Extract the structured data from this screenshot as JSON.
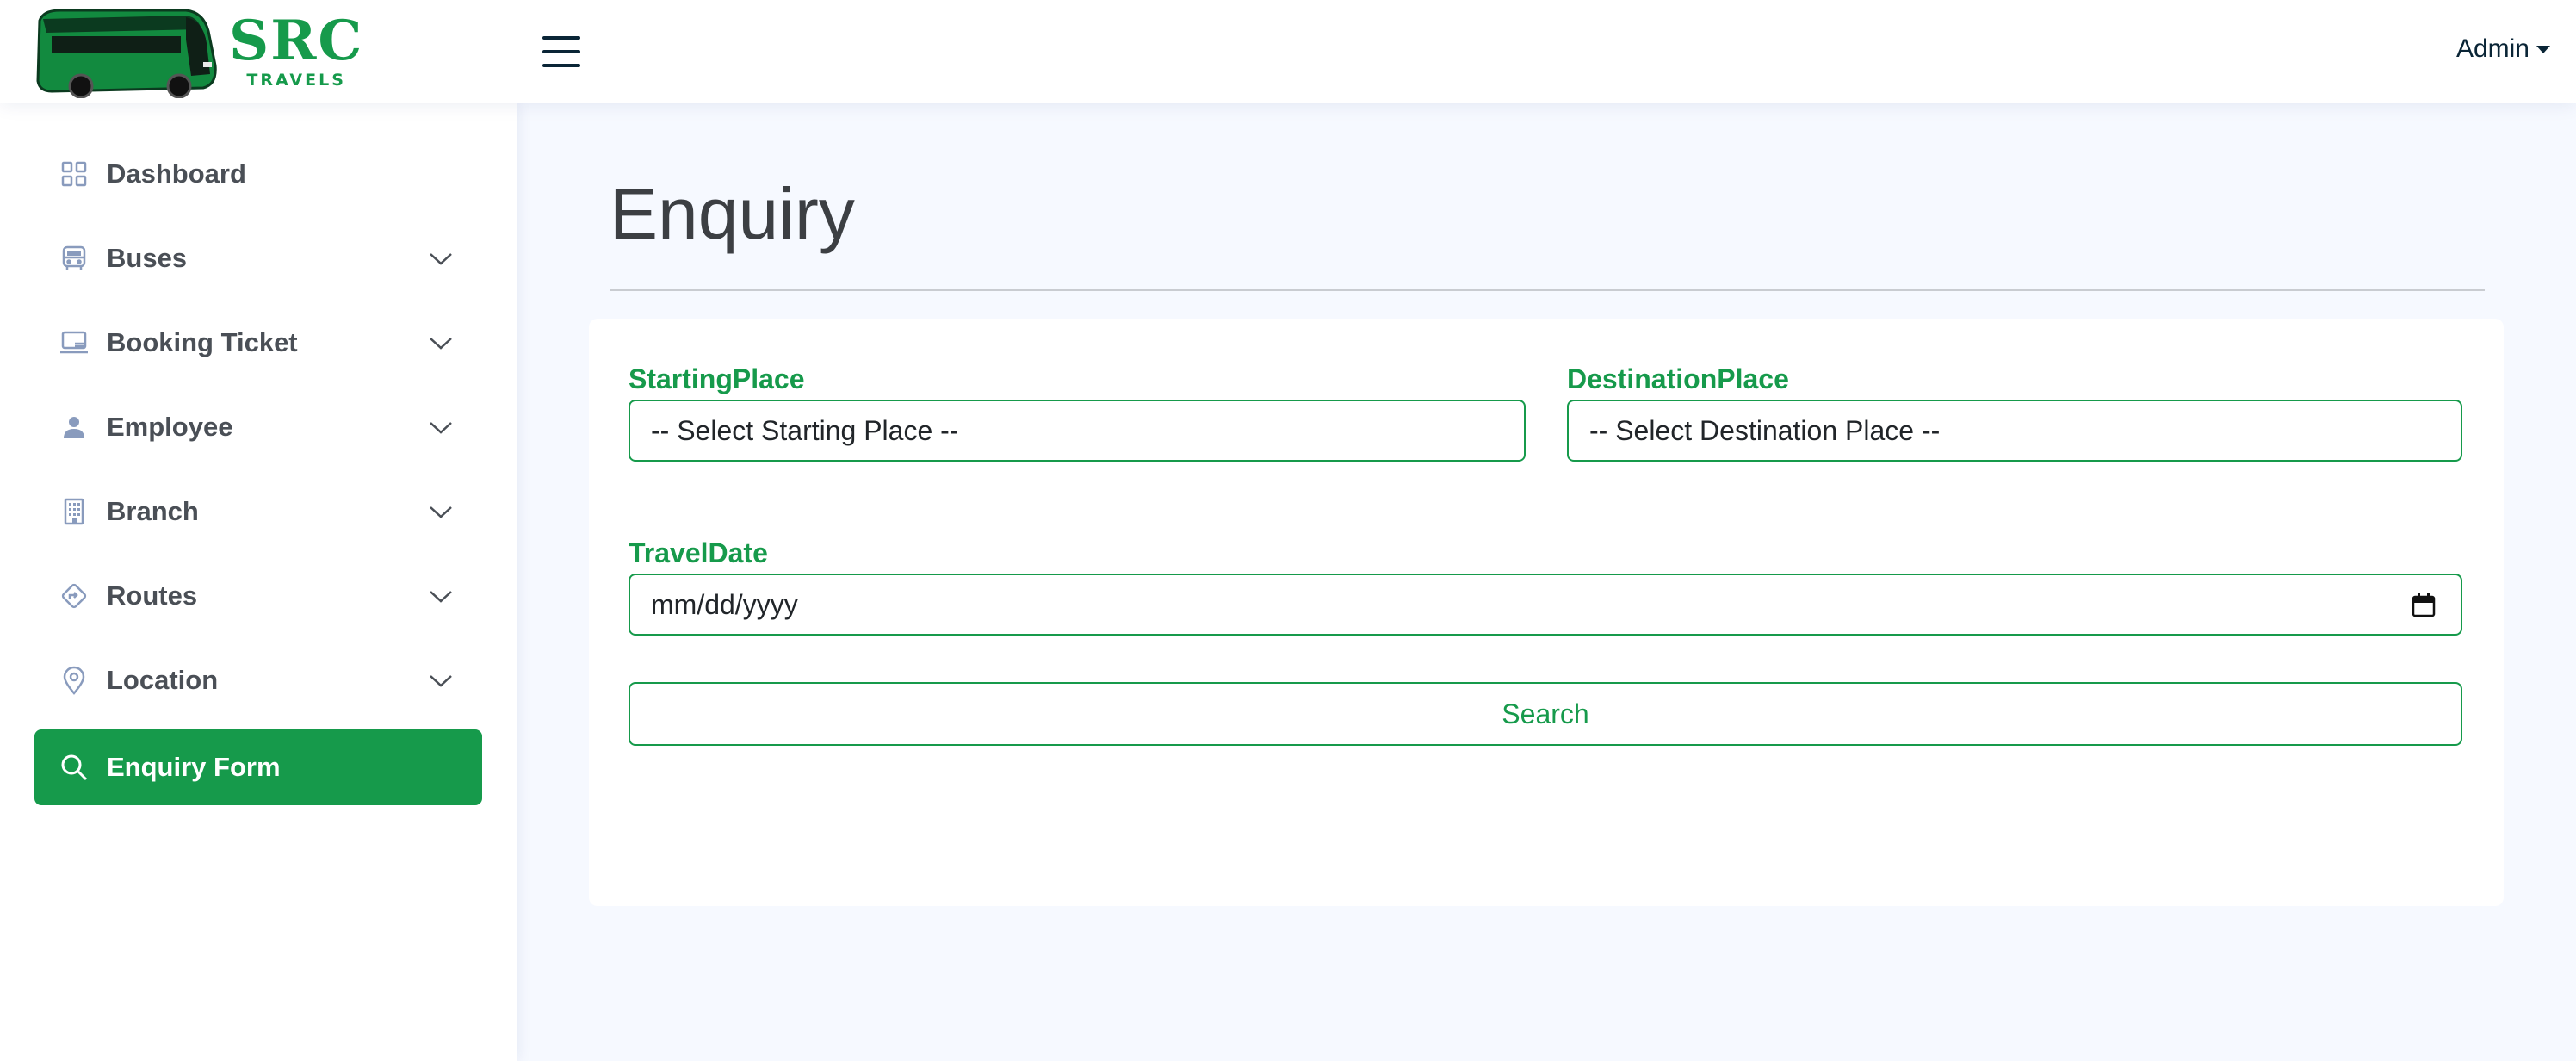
{
  "brand": {
    "name": "SRC",
    "tagline": "TRAVELS",
    "color": "#169a4b"
  },
  "header": {
    "menu_icon": "hamburger-icon",
    "user_label": "Admin"
  },
  "sidebar": {
    "items": [
      {
        "label": "Dashboard",
        "icon": "grid-icon",
        "expandable": false
      },
      {
        "label": "Buses",
        "icon": "bus-icon",
        "expandable": true
      },
      {
        "label": "Booking Ticket",
        "icon": "laptop-icon",
        "expandable": true
      },
      {
        "label": "Employee",
        "icon": "person-icon",
        "expandable": true
      },
      {
        "label": "Branch",
        "icon": "building-icon",
        "expandable": true
      },
      {
        "label": "Routes",
        "icon": "signpost-icon",
        "expandable": true
      },
      {
        "label": "Location",
        "icon": "geo-pin-icon",
        "expandable": true
      },
      {
        "label": "Enquiry Form",
        "icon": "search-icon",
        "expandable": false,
        "active": true
      }
    ]
  },
  "main": {
    "title": "Enquiry",
    "form": {
      "starting_label": "StartingPlace",
      "starting_value": "-- Select Starting Place --",
      "destination_label": "DestinationPlace",
      "destination_value": "-- Select Destination Place --",
      "date_label": "TravelDate",
      "date_value": "mm/dd/yyyy",
      "search_label": "Search"
    }
  },
  "colors": {
    "accent": "#169a4b",
    "background": "#f6f9ff",
    "text_dark": "#3c3f43"
  }
}
